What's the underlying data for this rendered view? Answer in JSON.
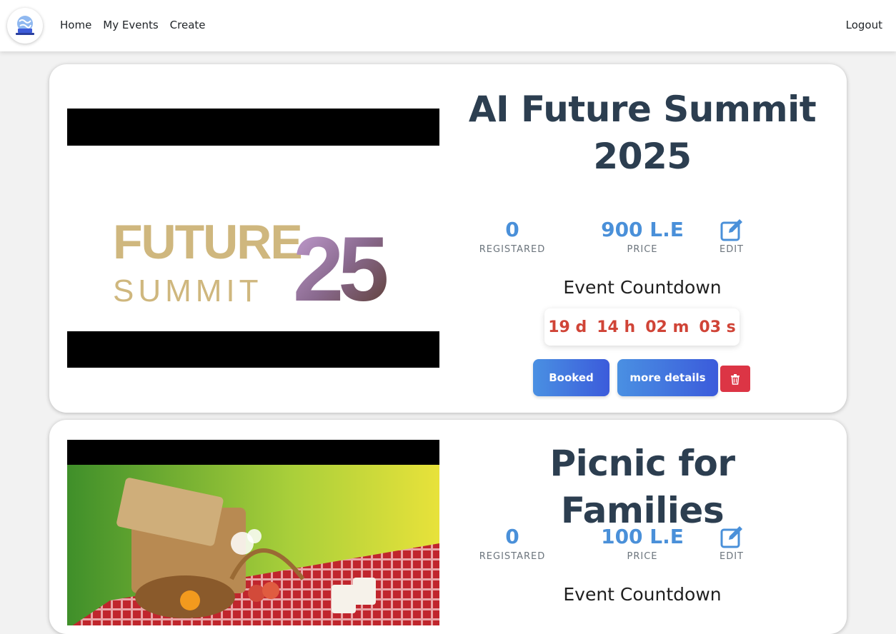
{
  "nav": {
    "links": [
      "Home",
      "My Events",
      "Create"
    ],
    "logout": "Logout"
  },
  "events": [
    {
      "title_line1": "AI Future Summit",
      "title_line2": "2025",
      "registered": "0",
      "registered_label": "REGISTARED",
      "price": "900 L.E",
      "price_label": "PRICE",
      "edit_label": "EDIT",
      "countdown_title": "Event Countdown",
      "countdown": {
        "days": "19 d",
        "hours": "14 h",
        "minutes": "02 m",
        "seconds": "03 s"
      },
      "booked_label": "Booked",
      "details_label": "more details",
      "logo_text_top": "FUTURE",
      "logo_text_bottom": "SUMMIT",
      "logo_number": "25"
    },
    {
      "title": "Picnic for Families",
      "registered": "0",
      "registered_label": "REGISTARED",
      "price": "100 L.E",
      "price_label": "PRICE",
      "edit_label": "EDIT",
      "countdown_title": "Event Countdown"
    }
  ],
  "colors": {
    "title": "#2c3e50",
    "stat_value": "#4a90d9",
    "countdown": "#d04437",
    "delete": "#dc3545",
    "button_gradient": [
      "#4a90e2",
      "#3b5bdb"
    ]
  }
}
